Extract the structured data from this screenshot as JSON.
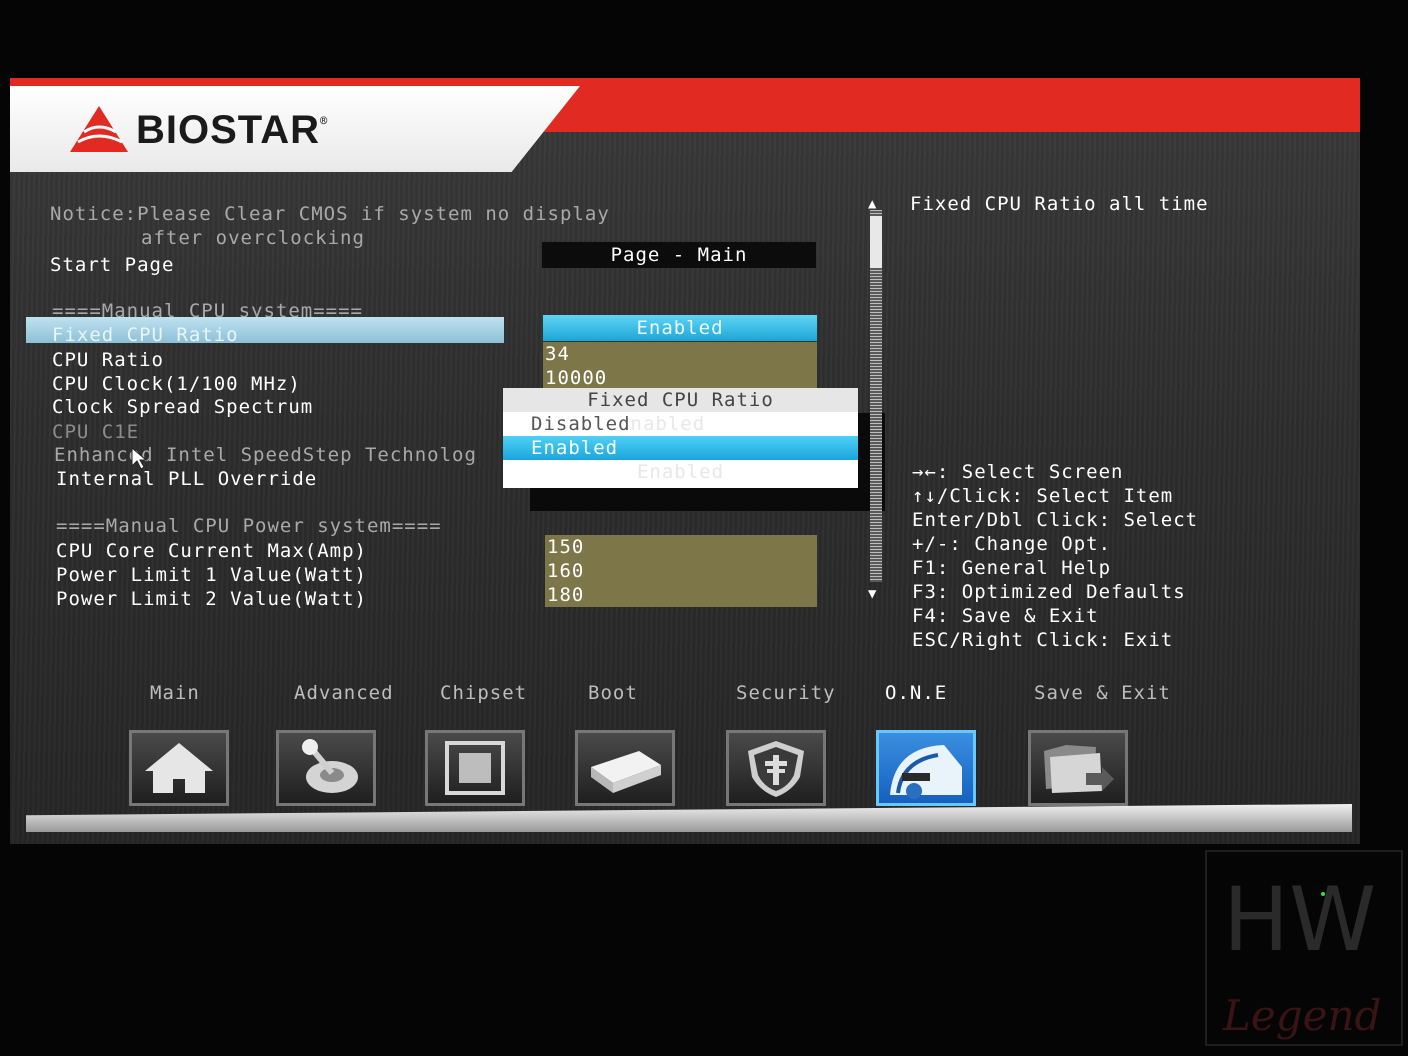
{
  "brand": {
    "name": "BIOSTAR",
    "registered": "®"
  },
  "notice": {
    "line1": "Notice:Please Clear CMOS if system no display",
    "line2": "after overclocking"
  },
  "start_page": "Start Page",
  "page_title": "Page - Main",
  "sections": {
    "cpu_system": "====Manual CPU system====",
    "cpu_power": "====Manual CPU Power system===="
  },
  "settings": [
    {
      "label": "Fixed CPU Ratio",
      "value": "Enabled",
      "state": "selected"
    },
    {
      "label": "CPU Ratio",
      "value": "34",
      "state": "normal"
    },
    {
      "label": "CPU Clock(1/100 MHz)",
      "value": "10000",
      "state": "normal"
    },
    {
      "label": "Clock Spread Spectrum",
      "value": "",
      "state": "normal"
    },
    {
      "label": "CPU C1E",
      "value": "",
      "state": "disabled"
    },
    {
      "label": "Enhanced Intel SpeedStep Technolog",
      "value": "",
      "state": "dim"
    },
    {
      "label": "Internal PLL Override",
      "value": "Enabled",
      "state": "normal"
    }
  ],
  "power_settings": [
    {
      "label": "CPU Core Current Max(Amp)",
      "value": "150"
    },
    {
      "label": "Power Limit 1 Value(Watt)",
      "value": "160"
    },
    {
      "label": "Power Limit 2 Value(Watt)",
      "value": "180"
    }
  ],
  "popup": {
    "title": "Fixed CPU Ratio",
    "options": [
      "Disabled",
      "Enabled"
    ],
    "selected": "Enabled",
    "ghost_text": "nabled"
  },
  "help": {
    "description": "Fixed CPU Ratio all time",
    "keys": [
      "→←: Select Screen",
      "↑↓/Click: Select Item",
      "Enter/Dbl Click: Select",
      "+/-: Change Opt.",
      "F1: General Help",
      "F3: Optimized Defaults",
      "F4: Save & Exit",
      "ESC/Right Click: Exit"
    ]
  },
  "tabs": [
    {
      "label": "Main",
      "icon": "home-icon"
    },
    {
      "label": "Advanced",
      "icon": "joystick-icon"
    },
    {
      "label": "Chipset",
      "icon": "chip-icon"
    },
    {
      "label": "Boot",
      "icon": "drive-icon"
    },
    {
      "label": "Security",
      "icon": "shield-icon"
    },
    {
      "label": "O.N.E",
      "icon": "speedometer-icon",
      "active": true
    },
    {
      "label": "Save & Exit",
      "icon": "exit-folder-icon"
    }
  ],
  "watermark": {
    "top": "HW",
    "bottom": "Legend"
  },
  "colors": {
    "accent_red": "#e02a22",
    "highlight_blue": "#1ea6d6",
    "value_olive": "#7d7649"
  }
}
